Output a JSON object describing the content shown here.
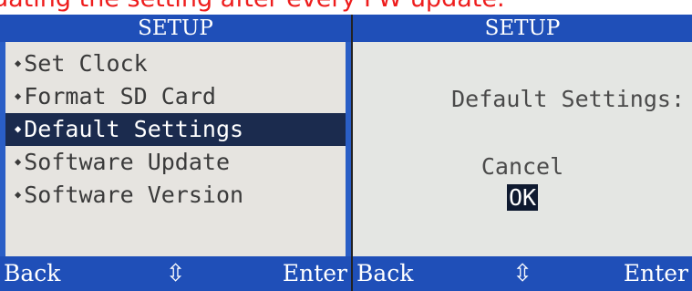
{
  "caption": "dating the setting after every FW update.",
  "left_screen": {
    "title": "SETUP",
    "menu_items": [
      "Set Clock",
      "Format SD Card",
      "Default Settings",
      "Software Update",
      "Software Version"
    ],
    "selected_index": 2,
    "footer": {
      "back": "Back",
      "nav": "⇳",
      "enter": "Enter"
    }
  },
  "right_screen": {
    "title": "SETUP",
    "prompt": "Default Settings:",
    "options": [
      "Cancel",
      "OK"
    ],
    "selected_option": "OK",
    "footer": {
      "back": "Back",
      "nav": "⇳",
      "enter": "Enter"
    }
  },
  "colors": {
    "caption": "#ee1d1d",
    "bar_blue": "#1f4fb8",
    "screen_bg": "#e6e4e0",
    "selected_bg": "#1b2b4e"
  },
  "icons": {
    "bullet": "bullet-icon",
    "nav": "up-down-arrow-icon"
  }
}
